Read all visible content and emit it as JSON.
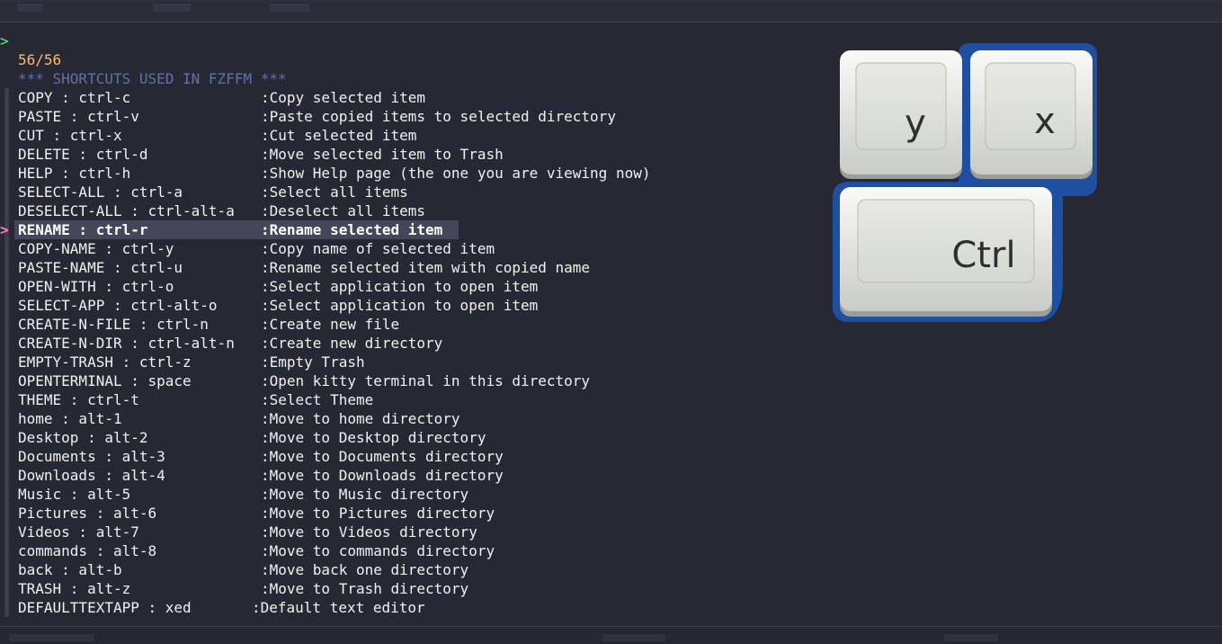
{
  "prompt": {
    "symbol": ">"
  },
  "counter": "56/56",
  "header": "*** SHORTCUTS USED IN FZFFM ***",
  "selected_pointer": ">",
  "shortcuts": [
    {
      "key": "COPY : ctrl-c",
      "description": ":Copy selected item"
    },
    {
      "key": "PASTE : ctrl-v",
      "description": ":Paste copied items to selected directory"
    },
    {
      "key": "CUT : ctrl-x",
      "description": ":Cut selected item"
    },
    {
      "key": "DELETE : ctrl-d",
      "description": ":Move selected item to Trash"
    },
    {
      "key": "HELP : ctrl-h",
      "description": ":Show Help page (the one you are viewing now)"
    },
    {
      "key": "SELECT-ALL : ctrl-a",
      "description": ":Select all items"
    },
    {
      "key": "DESELECT-ALL : ctrl-alt-a",
      "description": ":Deselect all items"
    },
    {
      "key": "RENAME : ctrl-r",
      "description": ":Rename selected item"
    },
    {
      "key": "COPY-NAME : ctrl-y",
      "description": ":Copy name of selected item"
    },
    {
      "key": "PASTE-NAME : ctrl-u",
      "description": ":Rename selected item with copied name"
    },
    {
      "key": "OPEN-WITH : ctrl-o",
      "description": ":Select application to open item"
    },
    {
      "key": "SELECT-APP : ctrl-alt-o",
      "description": ":Select application to open item"
    },
    {
      "key": "CREATE-N-FILE : ctrl-n",
      "description": ":Create new file"
    },
    {
      "key": "CREATE-N-DIR : ctrl-alt-n",
      "description": ":Create new directory"
    },
    {
      "key": "EMPTY-TRASH : ctrl-z",
      "description": ":Empty Trash"
    },
    {
      "key": "OPENTERMINAL : space",
      "description": ":Open kitty terminal in this directory"
    },
    {
      "key": "THEME : ctrl-t",
      "description": ":Select Theme"
    },
    {
      "key": "home : alt-1",
      "description": ":Move to home directory"
    },
    {
      "key": "Desktop : alt-2",
      "description": ":Move to Desktop directory"
    },
    {
      "key": "Documents : alt-3",
      "description": ":Move to Documents directory"
    },
    {
      "key": "Downloads : alt-4",
      "description": ":Move to Downloads directory"
    },
    {
      "key": "Music : alt-5",
      "description": ":Move to Music directory"
    },
    {
      "key": "Pictures : alt-6",
      "description": ":Move to Pictures directory"
    },
    {
      "key": "Videos : alt-7",
      "description": ":Move to Videos directory"
    },
    {
      "key": "commands : alt-8",
      "description": ":Move to commands directory"
    },
    {
      "key": "back : alt-b",
      "description": ":Move back one directory"
    },
    {
      "key": "TRASH : alt-z",
      "description": ":Move to Trash directory"
    },
    {
      "key": "DEFAULTTEXTAPP : xed",
      "description": ":Default text editor"
    }
  ],
  "key_labels": {
    "y": "y",
    "x": "x",
    "ctrl": "Ctrl"
  },
  "colors": {
    "background": "#262834",
    "prompt": "#50fa7b",
    "counter": "#ffb86c",
    "header": "#6272a4",
    "text": "#f1f1ee",
    "selection_bg": "#44475a",
    "pointer": "#ff79c6",
    "key_outline": "#1f4fa0"
  }
}
